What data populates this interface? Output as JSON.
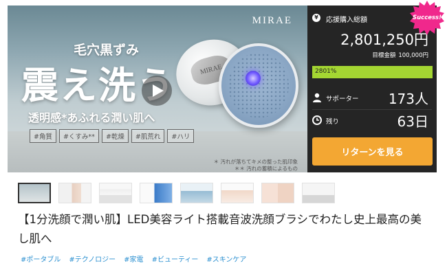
{
  "hero": {
    "brand": "MIRAE",
    "line1": "毛穴黒ずみ",
    "headline": "震え洗う",
    "line2": "透明感*あふれる潤い肌へ",
    "chips": [
      "#角質",
      "#くすみ**",
      "#乾燥",
      "#肌荒れ",
      "#ハリ"
    ],
    "notes": [
      "＊ 汚れが落ちてキメの整った肌印象",
      "＊＊ 汚れの蓄積によるもの"
    ],
    "device_logo": "MIRAE",
    "play_icon": "play-icon"
  },
  "badge": {
    "label": "Success!",
    "color": "#f0288c"
  },
  "funding": {
    "total_label": "応援購入総額",
    "total_amount": "2,801,250円",
    "target_label": "目標金額",
    "target_amount": "100,000円",
    "progress_label": "2801%",
    "progress_color": "#a4d632",
    "supporters_label": "サポーター",
    "supporters_value": "173人",
    "remaining_label": "残り",
    "remaining_value": "63日",
    "return_button": "リターンを見る",
    "button_color": "#f3a733"
  },
  "thumbnails": [
    {
      "name": "thumb-1",
      "active": true
    },
    {
      "name": "thumb-2"
    },
    {
      "name": "thumb-3"
    },
    {
      "name": "thumb-4"
    },
    {
      "name": "thumb-5"
    },
    {
      "name": "thumb-6"
    },
    {
      "name": "thumb-7"
    },
    {
      "name": "thumb-8"
    }
  ],
  "title": "【1分洗顔で潤い肌】LED美容ライト搭載音波洗顔ブラシでわたし史上最高の美し肌へ",
  "tags": [
    "#ポータブル",
    "#テクノロジー",
    "#家電",
    "#ビューティー",
    "#スキンケア"
  ],
  "link_color": "#2a8fd0"
}
